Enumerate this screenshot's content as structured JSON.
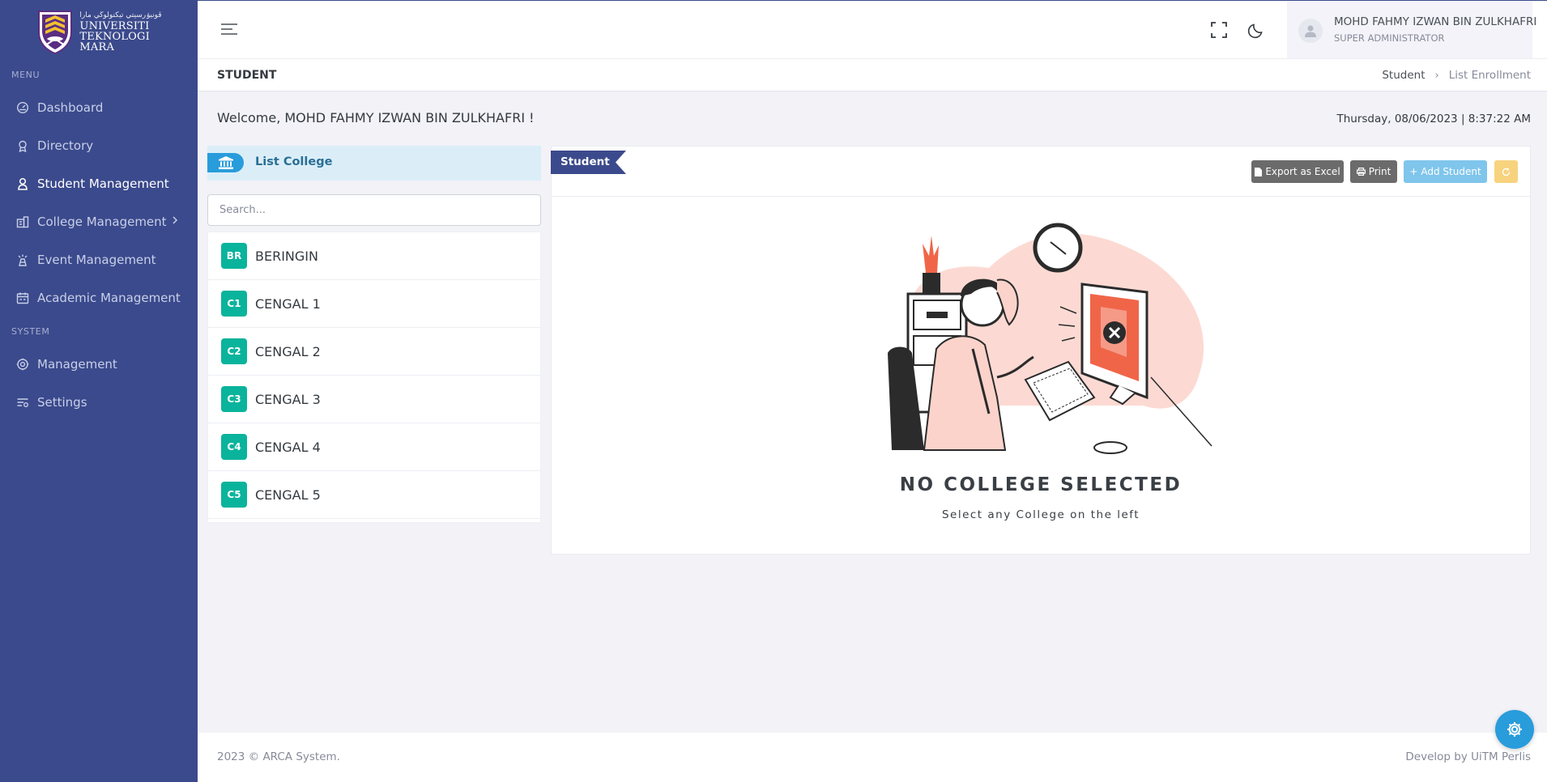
{
  "brand": {
    "jawi": "ڤونيۏرسيتي تيكنولوڬي مارا",
    "line1": "UNIVERSITI",
    "line2": "TEKNOLOGI",
    "line3": "MARA"
  },
  "sidebar": {
    "menu_title": "MENU",
    "system_title": "SYSTEM",
    "items": [
      {
        "label": "Dashboard",
        "icon": "dashboard-icon"
      },
      {
        "label": "Directory",
        "icon": "directory-icon"
      },
      {
        "label": "Student Management",
        "icon": "student-icon",
        "active": true
      },
      {
        "label": "College Management",
        "icon": "college-icon",
        "has_children": true
      },
      {
        "label": "Event Management",
        "icon": "event-icon"
      },
      {
        "label": "Academic Management",
        "icon": "academic-icon"
      }
    ],
    "system_items": [
      {
        "label": "Management",
        "icon": "gear-icon"
      },
      {
        "label": "Settings",
        "icon": "settings-icon"
      }
    ]
  },
  "topbar": {
    "user_name": "MOHD FAHMY IZWAN BIN ZULKHAFRI",
    "user_role": "SUPER ADMINISTRATOR"
  },
  "page": {
    "title": "STUDENT",
    "breadcrumb": [
      "Student",
      "List Enrollment"
    ],
    "welcome": "Welcome, MOHD FAHMY IZWAN BIN ZULKHAFRI !",
    "datetime": "Thursday, 08/06/2023 | 8:37:22 AM"
  },
  "colleges": {
    "header": "List College",
    "search_placeholder": "Search...",
    "items": [
      {
        "code": "BR",
        "name": "BERINGIN"
      },
      {
        "code": "C1",
        "name": "CENGAL 1"
      },
      {
        "code": "C2",
        "name": "CENGAL 2"
      },
      {
        "code": "C3",
        "name": "CENGAL 3"
      },
      {
        "code": "C4",
        "name": "CENGAL 4"
      },
      {
        "code": "C5",
        "name": "CENGAL 5"
      }
    ]
  },
  "student_card": {
    "ribbon": "Student",
    "export_label": "Export as Excel",
    "print_label": "Print",
    "add_label": "Add Student",
    "empty_title": "NO COLLEGE SELECTED",
    "empty_subtitle": "Select any College on the left"
  },
  "footer": {
    "left": "2023 © ARCA System.",
    "right": "Develop by UiTM Perlis"
  },
  "colors": {
    "sidebar": "#3b4a8c",
    "accent": "#299cdb",
    "badge": "#0ab39c",
    "add_button": "#7fc5ec",
    "refresh_button": "#f7d37e"
  }
}
